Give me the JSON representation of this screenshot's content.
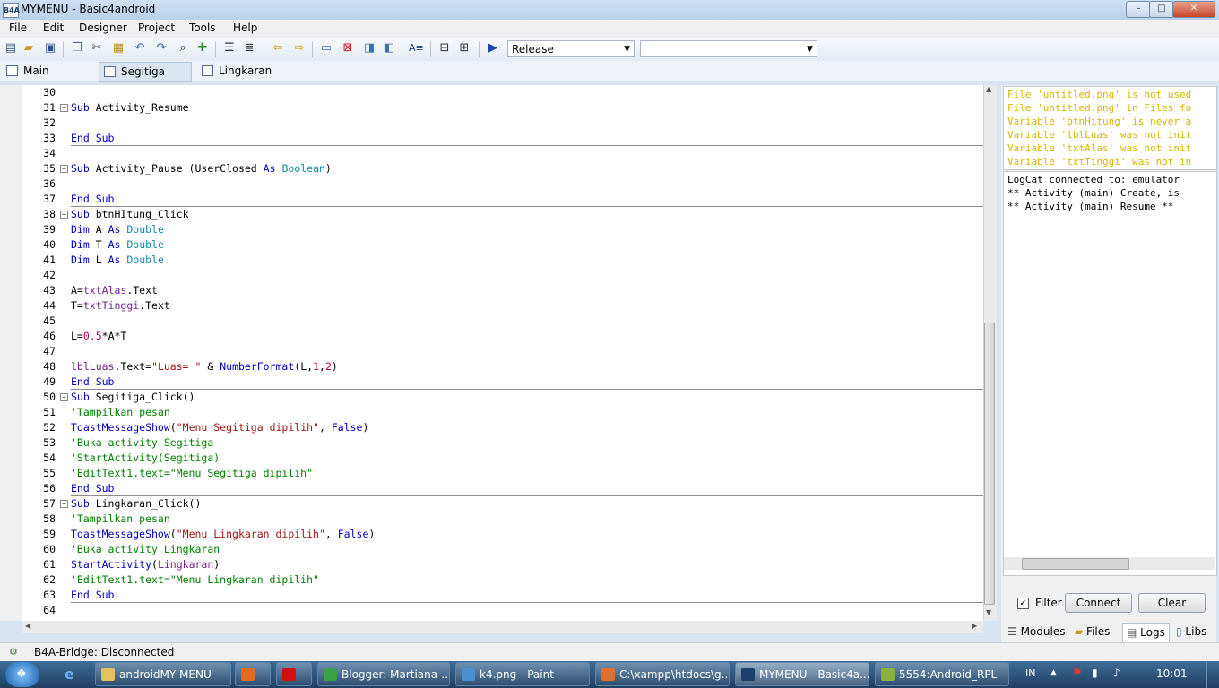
{
  "window": {
    "logo": "B4A",
    "title": "MYMENU - Basic4android",
    "min": "–",
    "max": "□",
    "close": "✕"
  },
  "menu": [
    "File",
    "Edit",
    "Designer",
    "Project",
    "Tools",
    "Help"
  ],
  "toolbar": {
    "build_config": "Release",
    "second_combo": ""
  },
  "tabs": [
    "Main",
    "Segitiga",
    "Lingkaran"
  ],
  "editor": {
    "lines": [
      {
        "n": "30",
        "html": ""
      },
      {
        "n": "31",
        "fold": true,
        "html": "<span class='kw'>Sub</span> Activity_Resume"
      },
      {
        "n": "32",
        "html": ""
      },
      {
        "n": "33",
        "sep": true,
        "html": "<span class='kw'>End Sub</span>"
      },
      {
        "n": "34",
        "html": ""
      },
      {
        "n": "35",
        "fold": true,
        "html": "<span class='kw'>Sub</span> Activity_Pause (UserClosed <span class='kw'>As</span> <span class='ty'>Boolean</span>)"
      },
      {
        "n": "36",
        "html": ""
      },
      {
        "n": "37",
        "sep": true,
        "html": "<span class='kw'>End Sub</span>"
      },
      {
        "n": "38",
        "fold": true,
        "html": "<span class='kw'>Sub</span> btnHItung_Click"
      },
      {
        "n": "39",
        "html": "<span class='kw'>Dim</span> A <span class='kw'>As</span> <span class='ty'>Double</span>"
      },
      {
        "n": "40",
        "html": "<span class='kw'>Dim</span> T <span class='kw'>As</span> <span class='ty'>Double</span>"
      },
      {
        "n": "41",
        "html": "<span class='kw'>Dim</span> L <span class='kw'>As</span> <span class='ty'>Double</span>"
      },
      {
        "n": "42",
        "html": ""
      },
      {
        "n": "43",
        "html": "A=<span class='vr'>txtAlas</span>.Text"
      },
      {
        "n": "44",
        "html": "T=<span class='vr'>txtTinggi</span>.Text"
      },
      {
        "n": "45",
        "html": ""
      },
      {
        "n": "46",
        "html": "L=<span class='nm'>0.5</span>*A*T"
      },
      {
        "n": "47",
        "html": ""
      },
      {
        "n": "48",
        "html": "<span class='vr'>lblLuas</span>.Text=<span class='st'>\"Luas= \"</span> &amp; <span class='kw'>NumberFormat</span>(L,<span class='nm'>1</span>,<span class='nm'>2</span>)"
      },
      {
        "n": "49",
        "sep": true,
        "html": "<span class='kw'>End Sub</span>"
      },
      {
        "n": "50",
        "fold": true,
        "html": "<span class='kw'>Sub</span> Segitiga_Click()"
      },
      {
        "n": "51",
        "html": "<span class='cm'>'Tampilkan pesan</span>"
      },
      {
        "n": "52",
        "html": "<span class='kw'>ToastMessageShow</span>(<span class='st'>\"Menu Segitiga dipilih\"</span>, <span class='kw'>False</span>)"
      },
      {
        "n": "53",
        "html": "<span class='cm'>'Buka activity Segitiga</span>"
      },
      {
        "n": "54",
        "html": "<span class='cm'>'StartActivity(Segitiga)</span>"
      },
      {
        "n": "55",
        "html": "<span class='cm'>'EditText1.text=\"Menu Segitiga dipilih\"</span>"
      },
      {
        "n": "56",
        "sep": true,
        "html": "<span class='kw'>End Sub</span>"
      },
      {
        "n": "57",
        "fold": true,
        "html": "<span class='kw'>Sub</span> Lingkaran_Click()"
      },
      {
        "n": "58",
        "html": "<span class='cm'>'Tampilkan pesan</span>"
      },
      {
        "n": "59",
        "html": "<span class='kw'>ToastMessageShow</span>(<span class='st'>\"Menu Lingkaran dipilih\"</span>, <span class='kw'>False</span>)"
      },
      {
        "n": "60",
        "html": "<span class='cm'>'Buka activity Lingkaran</span>"
      },
      {
        "n": "61",
        "html": "<span class='kw'>StartActivity</span>(<span class='vr'>Lingkaran</span>)"
      },
      {
        "n": "62",
        "html": "<span class='cm'>'EditText1.text=\"Menu Lingkaran dipilih\"</span>"
      },
      {
        "n": "63",
        "sep": true,
        "html": "<span class='kw'>End Sub</span>"
      },
      {
        "n": "64",
        "html": ""
      }
    ]
  },
  "warnings": [
    "File 'untitled.png' is not used",
    "File 'untitled.png' in Files fo",
    "Variable 'btnHitung' is never a",
    "Variable 'lblLuas' was not init",
    "Variable 'txtAlas' was not init",
    "Variable 'txtTinggi' was not in"
  ],
  "logs": [
    "LogCat connected to: emulator",
    "** Activity (main) Create, is",
    "** Activity (main) Resume **"
  ],
  "log_controls": {
    "filter_label": "Filter",
    "connect": "Connect",
    "clear": "Clear"
  },
  "right_tabs": [
    "Modules",
    "Files",
    "Logs",
    "Libs"
  ],
  "status": "B4A-Bridge: Disconnected",
  "taskbar": {
    "items": [
      {
        "label": "androidMY MENU",
        "color": "#e5c060"
      },
      {
        "label": "",
        "color": "#e06a20"
      },
      {
        "label": "",
        "color": "#d01010"
      },
      {
        "label": "Blogger: Martiana-...",
        "color": "#3aa04a"
      },
      {
        "label": "k4.png - Paint",
        "color": "#4a90d0"
      },
      {
        "label": "C:\\xampp\\htdocs\\g...",
        "color": "#e07030"
      },
      {
        "label": "MYMENU - Basic4a...",
        "color": "#1d3f6a"
      },
      {
        "label": "5554:Android_RPL",
        "color": "#8ab040"
      }
    ],
    "lang": "IN",
    "clock": "10:01"
  }
}
